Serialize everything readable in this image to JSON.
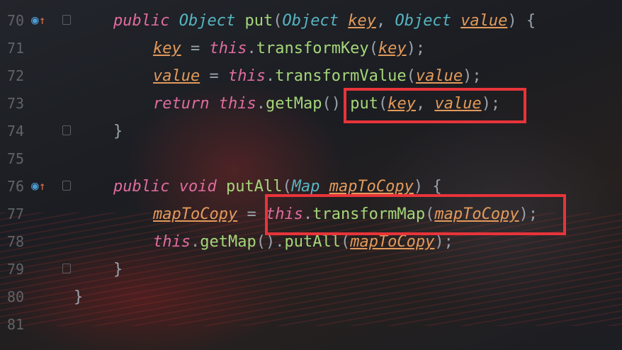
{
  "editor": {
    "lines": [
      {
        "number": "70",
        "gutter_icons": [
          "override-icon",
          "implements-up-arrow-icon"
        ]
      },
      {
        "number": "71"
      },
      {
        "number": "72"
      },
      {
        "number": "73"
      },
      {
        "number": "74"
      },
      {
        "number": "75"
      },
      {
        "number": "76",
        "gutter_icons": [
          "override-icon",
          "implements-up-arrow-icon"
        ]
      },
      {
        "number": "77"
      },
      {
        "number": "78"
      },
      {
        "number": "79"
      },
      {
        "number": "80"
      },
      {
        "number": "81"
      }
    ],
    "tokens": {
      "public": "public",
      "object": "Object",
      "put": "put",
      "key": "key",
      "value": "value",
      "this": "this",
      "transformKey": "transformKey",
      "transformValue": "transformValue",
      "return": "return",
      "getMap": "getMap",
      "void": "void",
      "putAll": "putAll",
      "map": "Map",
      "mapToCopy": "mapToCopy",
      "transformMap": "transformMap"
    }
  },
  "highlights": {
    "color": "#e8343a",
    "boxes": [
      "put(key, value) call on line 73",
      "this.transformMap(mapToCopy) on line 77"
    ]
  },
  "colors": {
    "keyword": "#e06c9f",
    "type": "#56b6c2",
    "method": "#a5d67a",
    "variable": "#e29a5b",
    "line_number": "#606366"
  }
}
